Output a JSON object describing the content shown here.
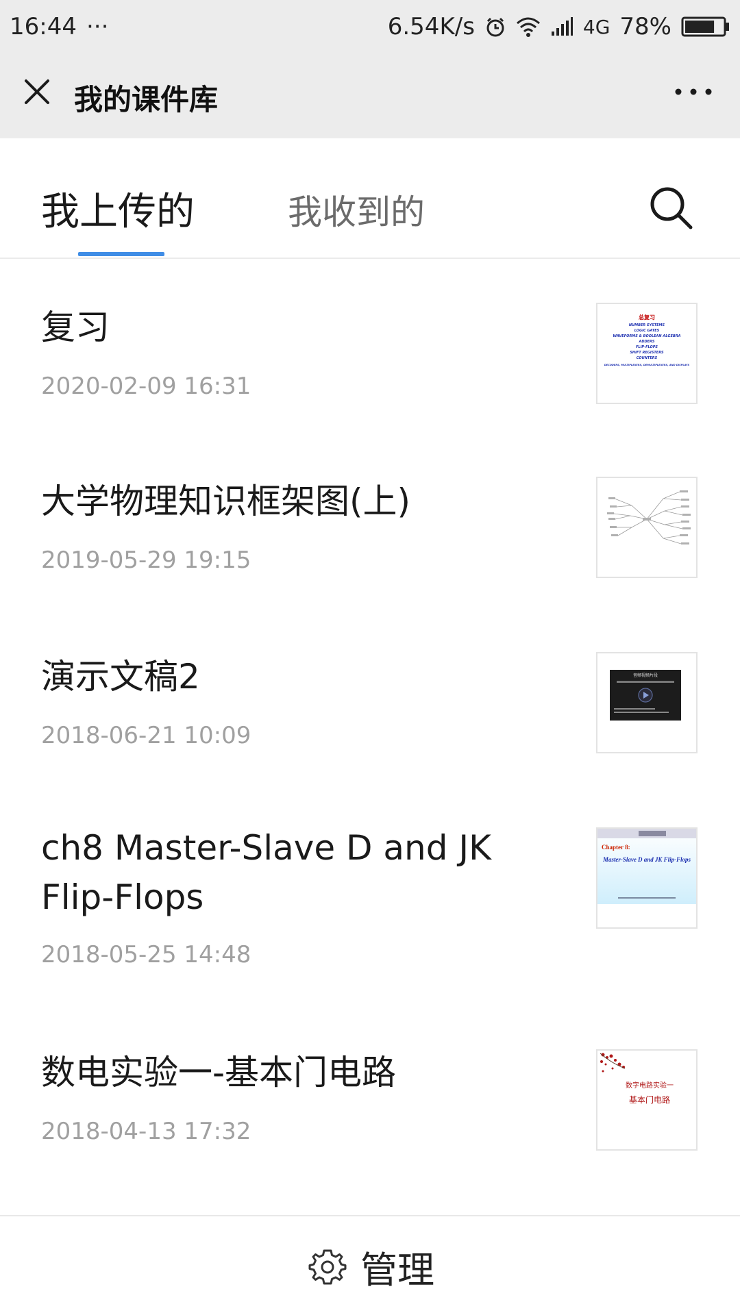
{
  "status_bar": {
    "time": "16:44",
    "dots": "···",
    "speed": "6.54K/s",
    "network": "4G",
    "battery": "78%",
    "battery_level": 0.78
  },
  "header": {
    "title": "我的课件库",
    "close_icon": "close-icon",
    "more_icon": "more-icon"
  },
  "tabs": [
    {
      "label": "我上传的",
      "active": true
    },
    {
      "label": "我收到的",
      "active": false
    }
  ],
  "accent_color": "#3f8de6",
  "items": [
    {
      "title": "复习",
      "date": "2020-02-09 16:31",
      "thumb": "number-systems-slide"
    },
    {
      "title": "大学物理知识框架图(上)",
      "date": "2019-05-29 19:15",
      "thumb": "mind-map-slide"
    },
    {
      "title": "演示文稿2",
      "date": "2018-06-21 10:09",
      "thumb": "video-slide"
    },
    {
      "title": "ch8 Master-Slave D and JK Flip-Flops",
      "date": "2018-05-25 14:48",
      "thumb": "chapter-slide"
    },
    {
      "title": "数电实验一-基本门电路",
      "date": "2018-04-13 17:32",
      "thumb": "lab-slide"
    }
  ],
  "thumbs": {
    "t1_heading": "总复习",
    "t1_lines": [
      "NUMBER SYSTEMS",
      "LOGIC GATES",
      "WAVEFORMS & BOOLEAN ALGEBRA",
      "ADDERS",
      "FLIP-FLOPS",
      "SHIFT REGISTERS",
      "COUNTERS",
      "DECODERS, MULTIPLEXERS, DEMULTIPLEXERS, AND DISPLAYS"
    ],
    "t3_heading": "音频视频片段",
    "t4_chapter": "Chapter 8:",
    "t4_title": "Master-Slave D and JK Flip-Flops",
    "t5_line1": "数字电路实验一",
    "t5_line2": "基本门电路"
  },
  "footer": {
    "manage_label": "管理",
    "icon": "gear-icon"
  }
}
